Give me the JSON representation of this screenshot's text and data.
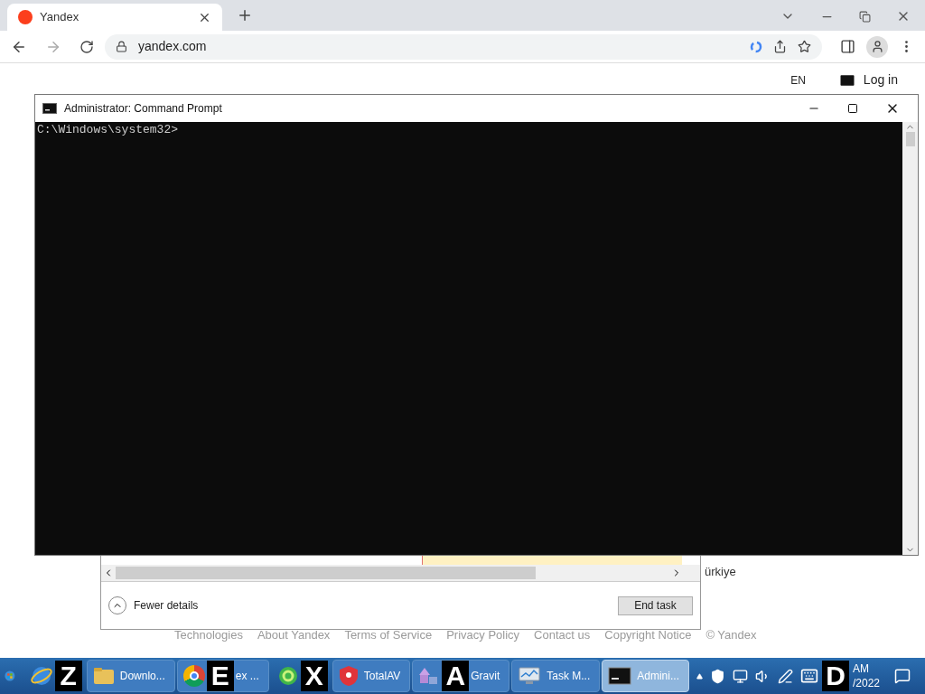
{
  "browser": {
    "tab": {
      "title": "Yandex"
    },
    "address": "yandex.com"
  },
  "page": {
    "language": "EN",
    "login": "Log in",
    "region": "ürkiye",
    "footer_links": [
      "Technologies",
      "About Yandex",
      "Terms of Service",
      "Privacy Policy",
      "Contact us",
      "Copyright Notice",
      "© Yandex"
    ]
  },
  "task_manager": {
    "fewer_details": "Fewer details",
    "end_task": "End task"
  },
  "command_prompt": {
    "title": "Administrator: Command Prompt",
    "prompt": "C:\\Windows\\system32>"
  },
  "taskbar": {
    "items": [
      {
        "kind": "ie",
        "badge": "Z",
        "active": false
      },
      {
        "kind": "folder",
        "label": "Downlo...",
        "active": false
      },
      {
        "kind": "chrome",
        "badge": "E",
        "label": "ex ...",
        "active": false
      },
      {
        "kind": "green",
        "badge": "X",
        "active": false
      },
      {
        "kind": "shield",
        "label": "TotalAV",
        "active": false
      },
      {
        "kind": "gravit",
        "label": "Gravit",
        "badge": "A",
        "active": false
      },
      {
        "kind": "taskmgr",
        "label": "Task M...",
        "active": false
      },
      {
        "kind": "cmd",
        "label": "Admini...",
        "active": true
      }
    ],
    "clock": {
      "badge": "D",
      "time": "AM",
      "date": "/2022"
    }
  }
}
